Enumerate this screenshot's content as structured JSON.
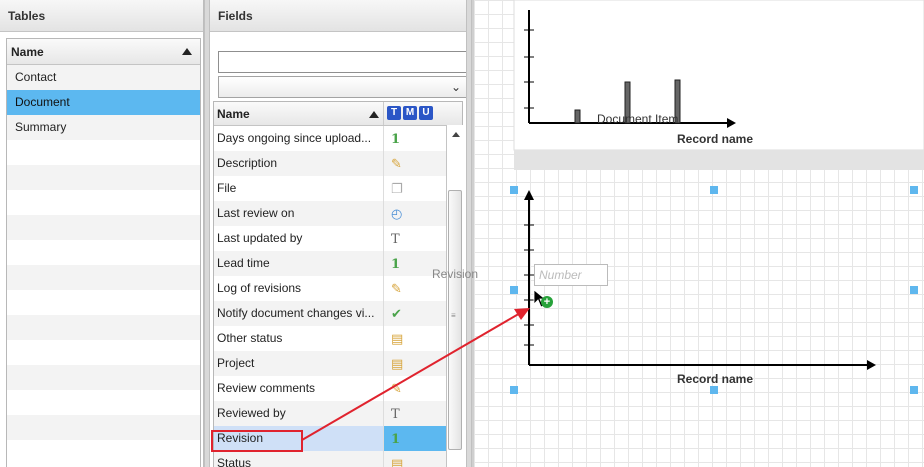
{
  "tables": {
    "title": "Tables",
    "column": "Name",
    "items": [
      "Contact",
      "Document",
      "Summary"
    ],
    "selected": "Document"
  },
  "fields": {
    "title": "Fields",
    "search_value": "",
    "filter_value": "",
    "column": "Name",
    "flags": [
      "T",
      "M",
      "U"
    ],
    "rows": [
      {
        "name": "Days ongoing since upload...",
        "icon": "number-icon"
      },
      {
        "name": "Description",
        "icon": "memo-icon"
      },
      {
        "name": "File",
        "icon": "file-icon"
      },
      {
        "name": "Last review on",
        "icon": "date-icon"
      },
      {
        "name": "Last updated by",
        "icon": "text-icon"
      },
      {
        "name": "Lead time",
        "icon": "number-icon"
      },
      {
        "name": "Log of revisions",
        "icon": "memo-icon"
      },
      {
        "name": "Notify document changes vi...",
        "icon": "checkbox-icon"
      },
      {
        "name": "Other status",
        "icon": "relation-icon"
      },
      {
        "name": "Project",
        "icon": "relation-icon"
      },
      {
        "name": "Review comments",
        "icon": "memo-icon"
      },
      {
        "name": "Reviewed by",
        "icon": "text-icon"
      },
      {
        "name": "Revision",
        "icon": "number-icon"
      },
      {
        "name": "Status",
        "icon": "relation-icon"
      }
    ],
    "selected": "Revision"
  },
  "canvas": {
    "drag_label": "Revision",
    "number_placeholder": "Number",
    "top_chart_caption": "Record name",
    "top_chart_item": "Document Item",
    "bottom_chart_caption": "Record name"
  },
  "colors": {
    "selection": "#5cb8f0",
    "annotation": "#e0232e",
    "handle": "#5fb7ee"
  }
}
